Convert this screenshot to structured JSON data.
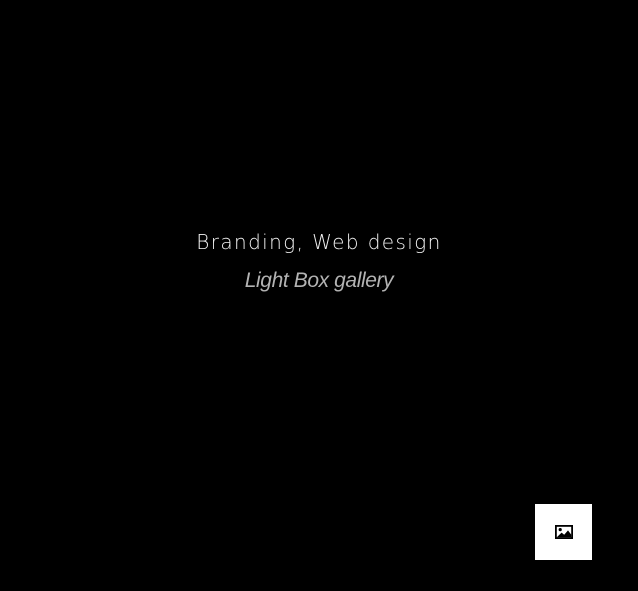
{
  "item": {
    "categories": "Branding, Web design",
    "title": "Light Box gallery"
  },
  "gallery_button": {
    "icon": "image-icon",
    "background": "#ffffff"
  },
  "colors": {
    "background": "#000000",
    "categories_text": "#f2f2f2",
    "title_text": "#b3b3b3",
    "icon": "#000000"
  }
}
